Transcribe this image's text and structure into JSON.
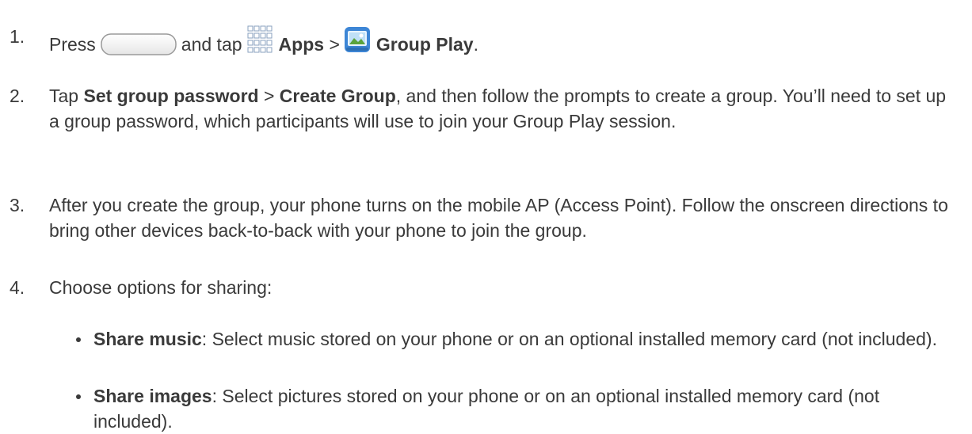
{
  "steps": {
    "s1": {
      "num": "1.",
      "press": "Press",
      "and_tap": "and tap",
      "apps": "Apps",
      "sep": ">",
      "group_play": "Group Play",
      "end": "."
    },
    "s2": {
      "num": "2.",
      "tap": "Tap",
      "set_pw": "Set group password",
      "sep": ">",
      "create": "Create Group",
      "rest": ", and then follow the prompts to create a group. You’ll need to set up a group password, which participants will use to join your Group Play session."
    },
    "s3": {
      "num": "3.",
      "text": "After you create the group, your phone turns on the mobile AP (Access Point). Follow the onscreen directions to bring other devices back-to-back with your phone to join the group."
    },
    "s4": {
      "num": "4.",
      "text": "Choose options for sharing:"
    }
  },
  "bullets": [
    {
      "label": "Share music",
      "text": ": Select music stored on your phone or on an optional installed memory card (not included)."
    },
    {
      "label": "Share images",
      "text": ": Select pictures stored on your phone or on an optional installed memory card (not included)."
    }
  ],
  "icons": {
    "home_key": "home-key-icon",
    "apps": "apps-grid-icon",
    "group_play": "group-play-icon"
  },
  "colors": {
    "text": "#3a3a3a"
  }
}
